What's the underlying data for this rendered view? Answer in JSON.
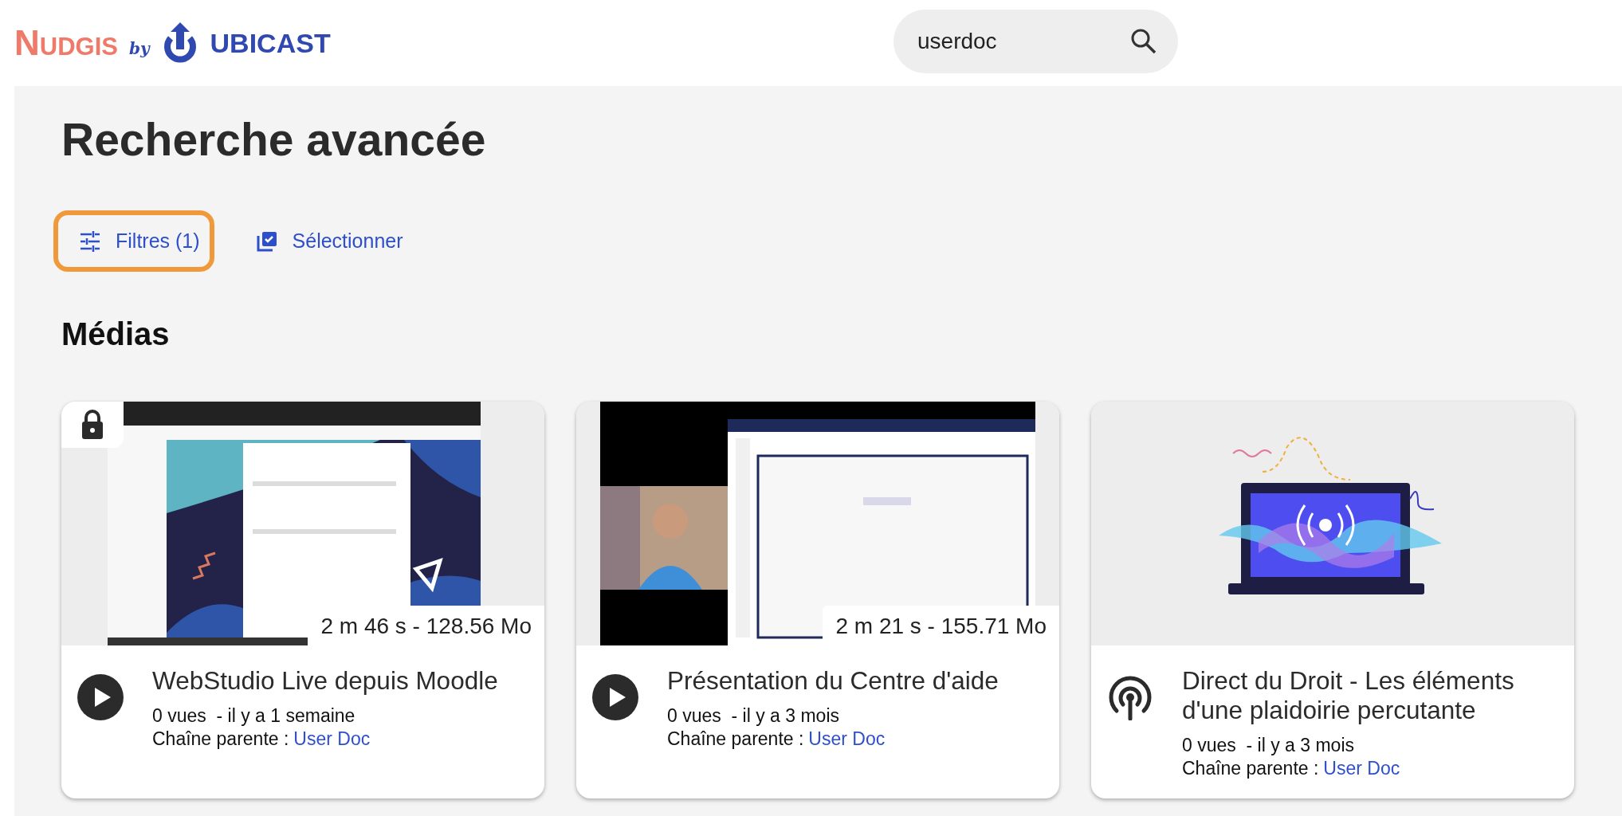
{
  "header": {
    "logo_brand": "Nudgis",
    "logo_by": "by",
    "logo_company": "UBICAST",
    "search": {
      "value": "userdoc"
    }
  },
  "page_title": "Recherche avancée",
  "toolbar": [
    {
      "kind": "filters",
      "label": "Filtres (1)",
      "selected": true
    },
    {
      "kind": "select",
      "label": "Sélectionner",
      "selected": false
    }
  ],
  "section_title": "Médias",
  "media": [
    {
      "kind": "video",
      "locked": true,
      "duration": "2 m 46 s - 128.56 Mo",
      "title": "WebStudio Live depuis Moodle",
      "meta": "0 vues  - il y a 1 semaine",
      "parent_label": "Chaîne parente :",
      "parent_link": "User Doc"
    },
    {
      "kind": "video",
      "locked": false,
      "duration": "2 m 21 s - 155.71 Mo",
      "title": "Présentation du Centre d'aide",
      "meta": "0 vues  - il y a 3 mois",
      "parent_label": "Chaîne parente :",
      "parent_link": "User Doc"
    },
    {
      "kind": "live",
      "locked": false,
      "title": "Direct du Droit - Les éléments d'une plaidoirie percutante",
      "meta": "0 vues  - il y a 3 mois",
      "parent_label": "Chaîne parente :",
      "parent_link": "User Doc"
    }
  ]
}
